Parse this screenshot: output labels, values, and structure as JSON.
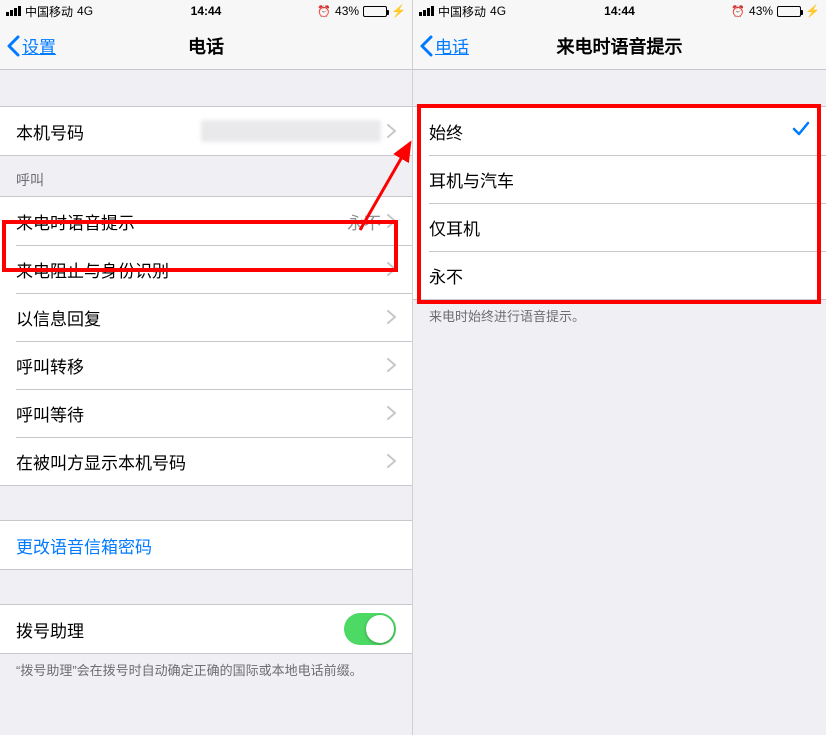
{
  "status_bar": {
    "carrier": "中国移动",
    "network": "4G",
    "time": "14:44",
    "alarm": "⏰",
    "battery_pct": "43%"
  },
  "left": {
    "nav": {
      "back": "设置",
      "title": "电话"
    },
    "my_number_label": "本机号码",
    "section_calls": "呼叫",
    "rows": {
      "announce": {
        "label": "来电时语音提示",
        "value": "永不"
      },
      "blocking": "来电阻止与身份识别",
      "respond_text": "以信息回复",
      "forwarding": "呼叫转移",
      "waiting": "呼叫等待",
      "show_id": "在被叫方显示本机号码",
      "change_vm_pw": "更改语音信箱密码",
      "dial_assist": "拨号助理"
    },
    "footnote": "“拨号助理”会在拨号时自动确定正确的国际或本地电话前缀。"
  },
  "right": {
    "nav": {
      "back": "电话",
      "title": "来电时语音提示"
    },
    "options": {
      "always": "始终",
      "headphones_car": "耳机与汽车",
      "headphones_only": "仅耳机",
      "never": "永不"
    },
    "footnote": "来电时始终进行语音提示。"
  }
}
